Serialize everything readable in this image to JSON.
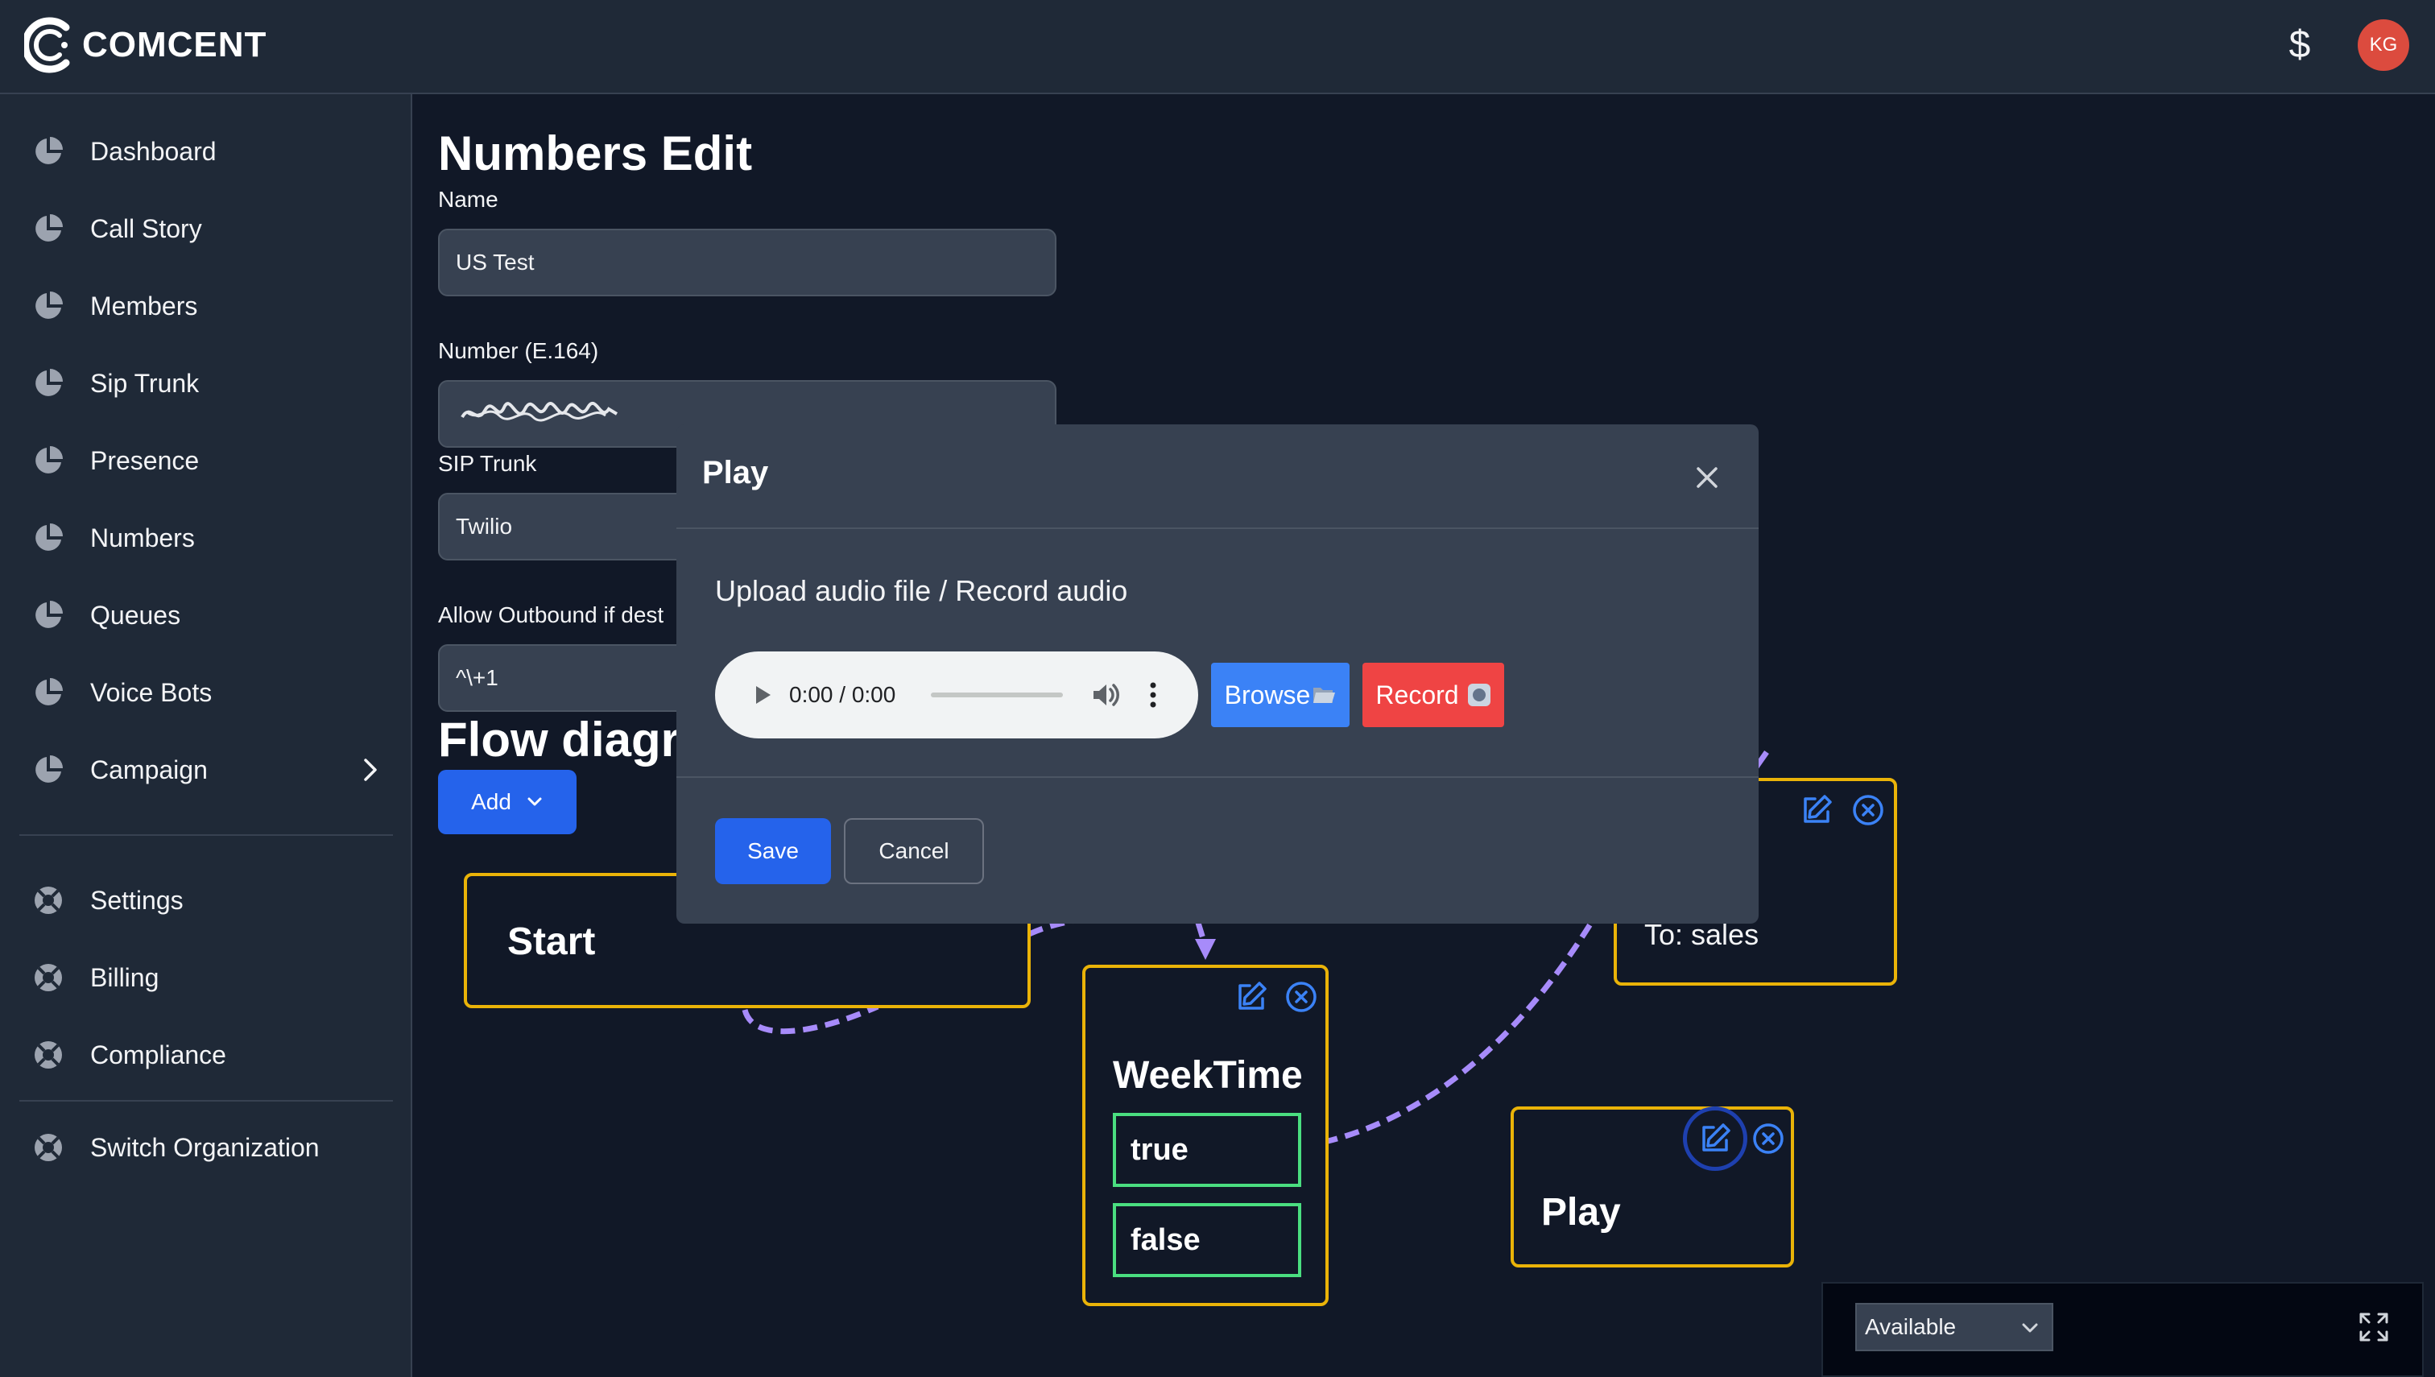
{
  "app": {
    "brand": "COMCENT",
    "currency_symbol": "$",
    "user_initials": "KG"
  },
  "sidebar": {
    "items": [
      {
        "label": "Dashboard",
        "icon": "pie-chart-icon"
      },
      {
        "label": "Call Story",
        "icon": "pie-chart-icon"
      },
      {
        "label": "Members",
        "icon": "pie-chart-icon"
      },
      {
        "label": "Sip Trunk",
        "icon": "pie-chart-icon"
      },
      {
        "label": "Presence",
        "icon": "pie-chart-icon"
      },
      {
        "label": "Numbers",
        "icon": "pie-chart-icon"
      },
      {
        "label": "Queues",
        "icon": "pie-chart-icon"
      },
      {
        "label": "Voice Bots",
        "icon": "pie-chart-icon"
      },
      {
        "label": "Campaign",
        "icon": "pie-chart-icon"
      }
    ],
    "secondary": [
      {
        "label": "Settings",
        "icon": "lifebuoy-icon"
      },
      {
        "label": "Billing",
        "icon": "lifebuoy-icon"
      },
      {
        "label": "Compliance",
        "icon": "lifebuoy-icon"
      }
    ],
    "tertiary": [
      {
        "label": "Switch Organization",
        "icon": "lifebuoy-icon"
      }
    ]
  },
  "form": {
    "title": "Numbers Edit",
    "name_label": "Name",
    "name_value": "US Test",
    "number_label": "Number (E.164)",
    "sip_label": "SIP Trunk",
    "sip_value": "Twilio",
    "outbound_label": "Allow Outbound if dest",
    "outbound_value": "^\\+1"
  },
  "flow": {
    "title": "Flow diagra",
    "add_label": "Add",
    "nodes": {
      "start": {
        "title": "Start"
      },
      "weektime": {
        "title": "WeekTime",
        "branches": [
          "true",
          "false"
        ]
      },
      "transfer": {
        "to_text": "To: sales"
      },
      "play": {
        "title": "Play"
      }
    }
  },
  "modal": {
    "title": "Play",
    "subtitle": "Upload audio file / Record audio",
    "audio_time": "0:00 / 0:00",
    "browse_label": "Browse",
    "record_label": "Record",
    "save_label": "Save",
    "cancel_label": "Cancel"
  },
  "status": {
    "selected": "Available"
  },
  "colors": {
    "accent_blue": "#2563eb",
    "record_red": "#ef4444",
    "node_border": "#eab308",
    "branch_border": "#4ade80",
    "edge_purple": "#a78bfa"
  }
}
